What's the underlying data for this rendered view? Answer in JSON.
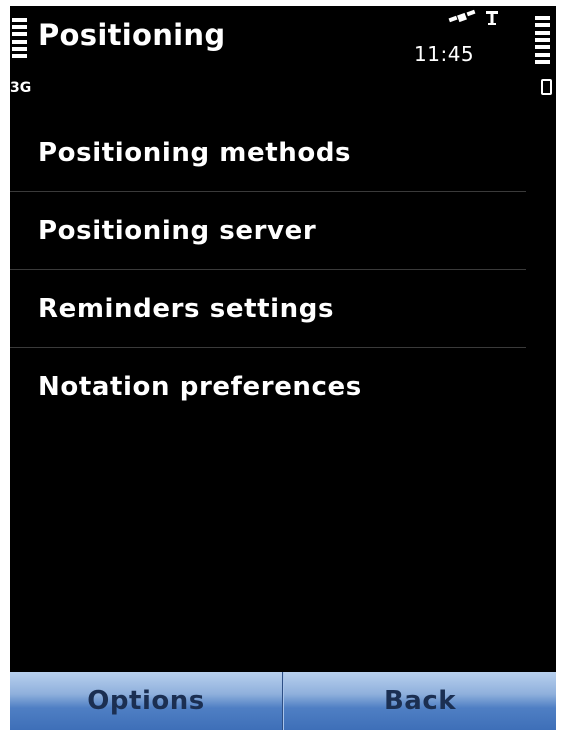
{
  "status_bar": {
    "title": "Positioning",
    "network": "3G",
    "time": "11:45"
  },
  "icons": {
    "signal": "signal-strength-icon",
    "gps": "gps-satellite-icon",
    "antenna": "antenna-icon",
    "battery_level": "battery-level-icon",
    "battery": "battery-icon"
  },
  "menu": {
    "items": [
      {
        "label": "Positioning methods"
      },
      {
        "label": "Positioning server"
      },
      {
        "label": "Reminders settings"
      },
      {
        "label": "Notation preferences"
      }
    ]
  },
  "softkeys": {
    "left": "Options",
    "right": "Back"
  },
  "colors": {
    "background": "#000000",
    "text": "#ffffff",
    "softkey_top": "#b8d0ee",
    "softkey_bottom": "#3e6fb8",
    "softkey_text": "#1b2f52"
  }
}
